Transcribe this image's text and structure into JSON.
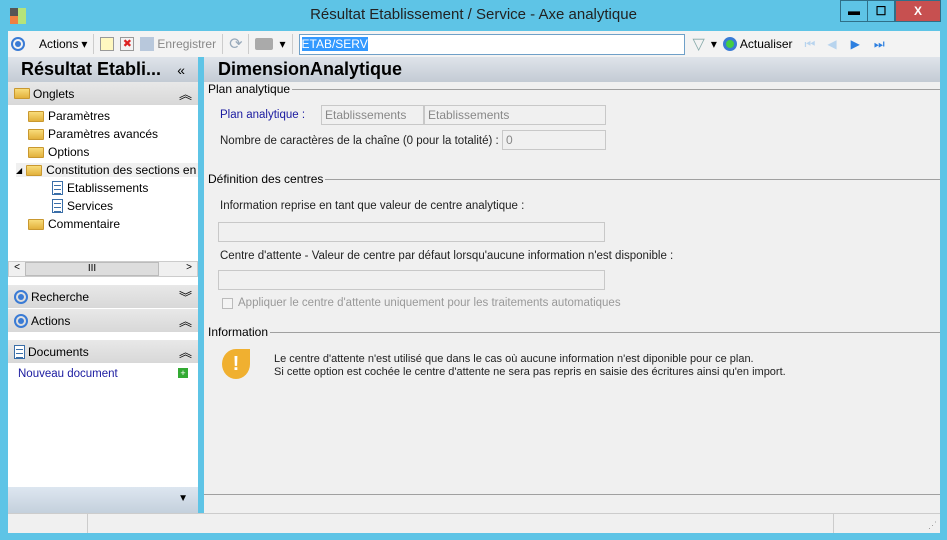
{
  "window": {
    "title": "Résultat Etablissement / Service -  Axe analytique",
    "minimize": "▬",
    "maximize": "☐",
    "close": "X"
  },
  "toolbar": {
    "actions_label": "Actions",
    "save_label": "Enregistrer",
    "search_value": "ETAB/SERV",
    "refresh_label": "Actualiser"
  },
  "left": {
    "title": "Résultat Etabli...",
    "collapse": "«",
    "onglets": {
      "label": "Onglets",
      "items": [
        "Paramètres",
        "Paramètres avancés",
        "Options",
        "Constitution des sections en",
        "Etablissements",
        "Services",
        "Commentaire"
      ]
    },
    "recherche": "Recherche",
    "actions": "Actions",
    "documents": "Documents",
    "new_document": "Nouveau document"
  },
  "main": {
    "title": "DimensionAnalytique",
    "plan": {
      "group": "Plan analytique",
      "label": "Plan analytique :",
      "value1": "Etablissements",
      "value2": "Etablissements",
      "nb_label": "Nombre de caractères de la chaîne (0 pour la totalité) :",
      "nb_value": "0"
    },
    "definition": {
      "group": "Définition des centres",
      "info_label": "Information reprise en tant que valeur de centre analytique :",
      "attente_label": "Centre d'attente - Valeur de centre par défaut lorsqu'aucune information n'est disponible :",
      "checkbox_label": "Appliquer le centre d'attente uniquement pour les traitements automatiques"
    },
    "information": {
      "group": "Information",
      "line1": "Le centre d'attente n'est utilisé que dans le cas où aucune information n'est diponible pour ce plan.",
      "line2": "Si cette option est cochée le centre d'attente ne sera pas repris en saisie des écritures ainsi qu'en import."
    }
  }
}
